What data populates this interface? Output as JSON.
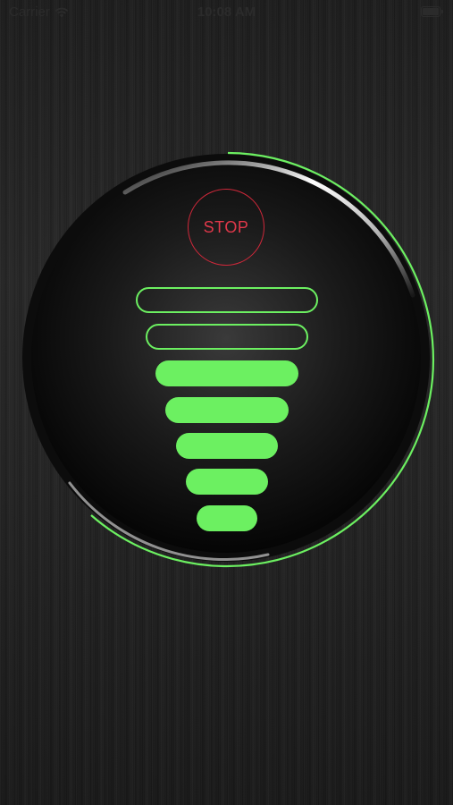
{
  "status_bar": {
    "carrier": "Carrier",
    "time": "10:08 AM"
  },
  "dial": {
    "stop_label": "STOP",
    "accent_color": "#6cf061",
    "stop_color": "#e0384a",
    "level": {
      "active_bars": 5,
      "total_bars": 7
    },
    "progress_ring_fraction": 0.62
  },
  "icons": {
    "wifi": "wifi-icon",
    "battery": "battery-icon"
  }
}
